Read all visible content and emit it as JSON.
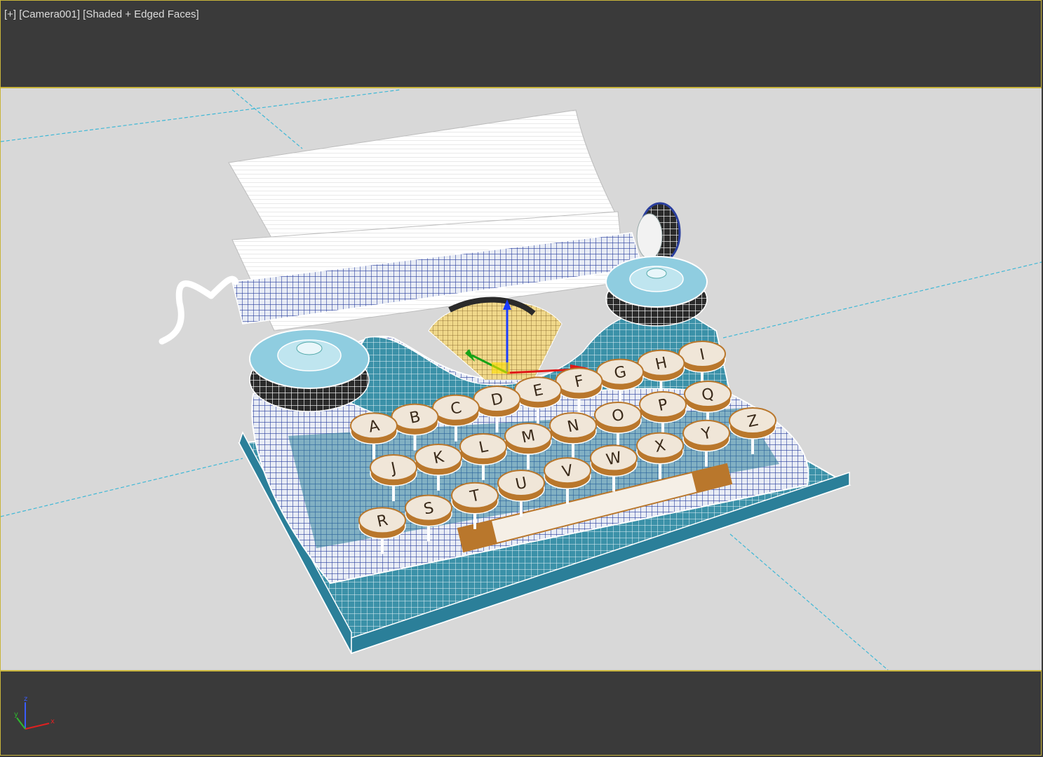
{
  "viewport": {
    "label_plus": "[+]",
    "label_camera": "[Camera001]",
    "label_shading": "[Shaded + Edged Faces]"
  },
  "keys": {
    "row1": [
      "I",
      "H",
      "G",
      "F",
      "E",
      "D",
      "C",
      "B",
      "A"
    ],
    "row2": [
      "Q",
      "P",
      "O",
      "N",
      "M",
      "L",
      "K",
      "J"
    ],
    "row3": [
      "Z",
      "Y",
      "X",
      "W",
      "V",
      "U",
      "T",
      "S",
      "R"
    ]
  },
  "gizmo": {
    "x": "x",
    "y": "y",
    "z": "z"
  },
  "colors": {
    "frame_active": "#c8b43a",
    "viewport_bg": "#d8d8d8",
    "panel_bg": "#3a3a3a",
    "grid_line": "#3fb8d6",
    "body_teal": "#2b7f99",
    "wire_blue": "#2a3f9e",
    "key_face": "#f0e6d8",
    "key_rim": "#b9772c"
  }
}
